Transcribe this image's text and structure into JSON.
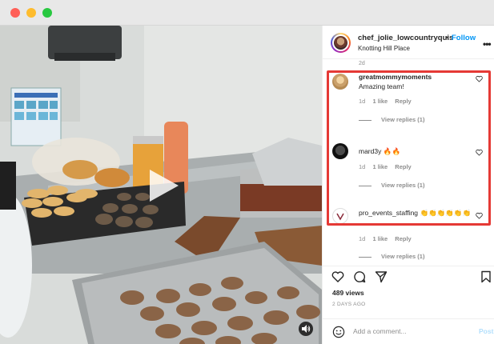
{
  "window": {
    "controls": [
      "close",
      "minimize",
      "zoom"
    ]
  },
  "post": {
    "username": "chef_jolie_lowcountryquis",
    "separator": "•",
    "follow_label": "Follow",
    "location": "Knotting Hill Place",
    "more_icon": "more-horizontal-icon"
  },
  "comments": {
    "partial_text": "2d",
    "items": [
      {
        "username": "greatmommymoments",
        "text": "Amazing team!",
        "age": "1d",
        "likes": "1 like",
        "reply_label": "Reply",
        "view_replies": "View replies (1)"
      },
      {
        "username": "mard3y",
        "text": "🔥🔥",
        "age": "1d",
        "likes": "1 like",
        "reply_label": "Reply",
        "view_replies": "View replies (1)"
      },
      {
        "username": "pro_events_staffing",
        "text": "👏👏👏👏👏👏",
        "age": "1d",
        "likes": "1 like",
        "reply_label": "Reply",
        "view_replies": "View replies (1)"
      }
    ]
  },
  "stats": {
    "views": "489 views",
    "date": "2 DAYS AGO"
  },
  "composer": {
    "placeholder": "Add a comment...",
    "post_label": "Post"
  },
  "colors": {
    "accent": "#0095f6",
    "highlight": "#e53935",
    "muted": "#8e8e8e"
  }
}
